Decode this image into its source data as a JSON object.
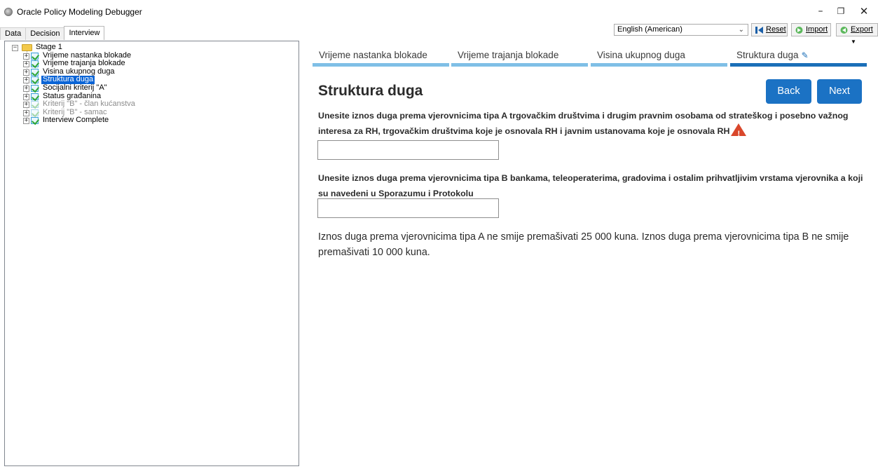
{
  "window": {
    "title": "Oracle Policy Modeling Debugger",
    "controls": {
      "minimize": "–",
      "restore": "❐",
      "close": "✕"
    }
  },
  "left_tabs": [
    "Data",
    "Decision",
    "Interview"
  ],
  "active_tab": "Interview",
  "tree": {
    "root": "Stage 1",
    "items": [
      {
        "label": "Vrijeme nastanka blokade",
        "state": "normal"
      },
      {
        "label": "Vrijeme trajanja blokade",
        "state": "normal"
      },
      {
        "label": "Visina ukupnog duga",
        "state": "normal"
      },
      {
        "label": "Struktura duga",
        "state": "selected"
      },
      {
        "label": "Socijalni kriterij \"A\"",
        "state": "normal"
      },
      {
        "label": "Status građanina",
        "state": "normal"
      },
      {
        "label": "Kriterij \"B\" - član kućanstva",
        "state": "disabled"
      },
      {
        "label": "Kriterij \"B\" - samac",
        "state": "disabled"
      },
      {
        "label": "Interview Complete",
        "state": "normal"
      }
    ]
  },
  "toolbar": {
    "language": "English (American)",
    "reset_label": "Reset",
    "import_label": "Import",
    "export_label": "Export"
  },
  "steps": [
    {
      "label": "Vrijeme nastanka blokade",
      "current": false
    },
    {
      "label": "Vrijeme trajanja blokade",
      "current": false
    },
    {
      "label": "Visina ukupnog duga",
      "current": false
    },
    {
      "label": "Struktura duga",
      "current": true
    }
  ],
  "main": {
    "title": "Struktura duga",
    "back_label": "Back",
    "next_label": "Next",
    "question1": "Unesite iznos duga prema vjerovnicima tipa A trgovačkim društvima i drugim pravnim osobama od strateškog i posebno važnog interesa za RH, trgovačkim društvima koje je osnovala RH i javnim ustanovama koje je osnovala RH",
    "question1_value": "",
    "question2": "Unesite iznos duga prema vjerovnicima tipa B bankama, teleoperaterima, gradovima i ostalim prihvatljivim vrstama vjerovnika a koji su navedeni u Sporazumu i Protokolu",
    "question2_value": "",
    "info": "Iznos duga prema vjerovnicima tipa A ne smije premašivati 25 000 kuna. Iznos duga prema vjerovnicima tipa B ne smije premašivati 10 000 kuna."
  },
  "colors": {
    "accent": "#1b72c4",
    "step_done": "#7fbfe6",
    "step_current": "#1b6fb8",
    "selection": "#0a64d6",
    "warning": "#d9472b"
  }
}
